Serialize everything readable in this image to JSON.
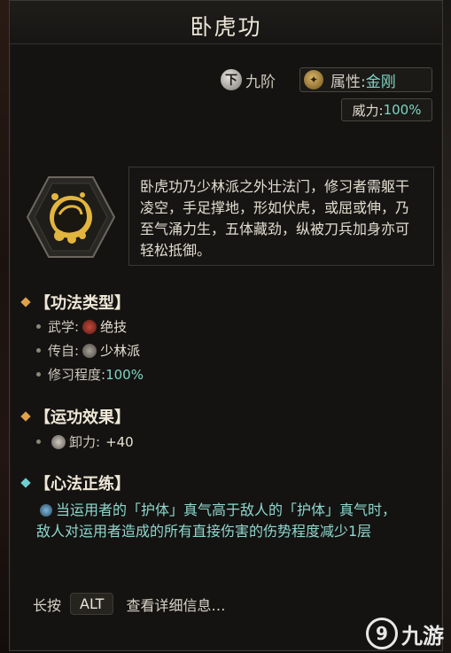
{
  "title": "卧虎功",
  "tier": {
    "badge": "下",
    "label": "九阶"
  },
  "attribute": {
    "label": "属性:",
    "value": "金刚"
  },
  "power": {
    "label": "威力:",
    "value": "100%"
  },
  "description": "卧虎功乃少林派之外壮法门，修习者需躯干凌空，手足撑地，形如伏虎，或屈或伸，乃至气涌力生，五体藏劲，纵被刀兵加身亦可轻松抵御。",
  "sections": {
    "type": {
      "heading": "【功法类型】",
      "items": [
        {
          "label": "武学:",
          "value": "绝技"
        },
        {
          "label": "传自:",
          "value": "少林派"
        },
        {
          "label": "修习程度:",
          "value": "100%"
        }
      ]
    },
    "effect": {
      "heading": "【运功效果】",
      "items": [
        {
          "label": "卸力:",
          "value": "+40"
        }
      ]
    },
    "mind": {
      "heading": "【心法正练】",
      "text": "当运用者的「护体」真气高于敌人的「护体」真气时，敌人对运用者造成的所有直接伤害的伤势程度减少1层"
    }
  },
  "footer": {
    "prefix": "长按",
    "key": "ALT",
    "suffix": "查看详细信息…"
  },
  "watermark": {
    "text": "九游"
  },
  "colors": {
    "teal": "#7fd4c4",
    "gold": "#e0a24a",
    "panel": "#141311"
  }
}
